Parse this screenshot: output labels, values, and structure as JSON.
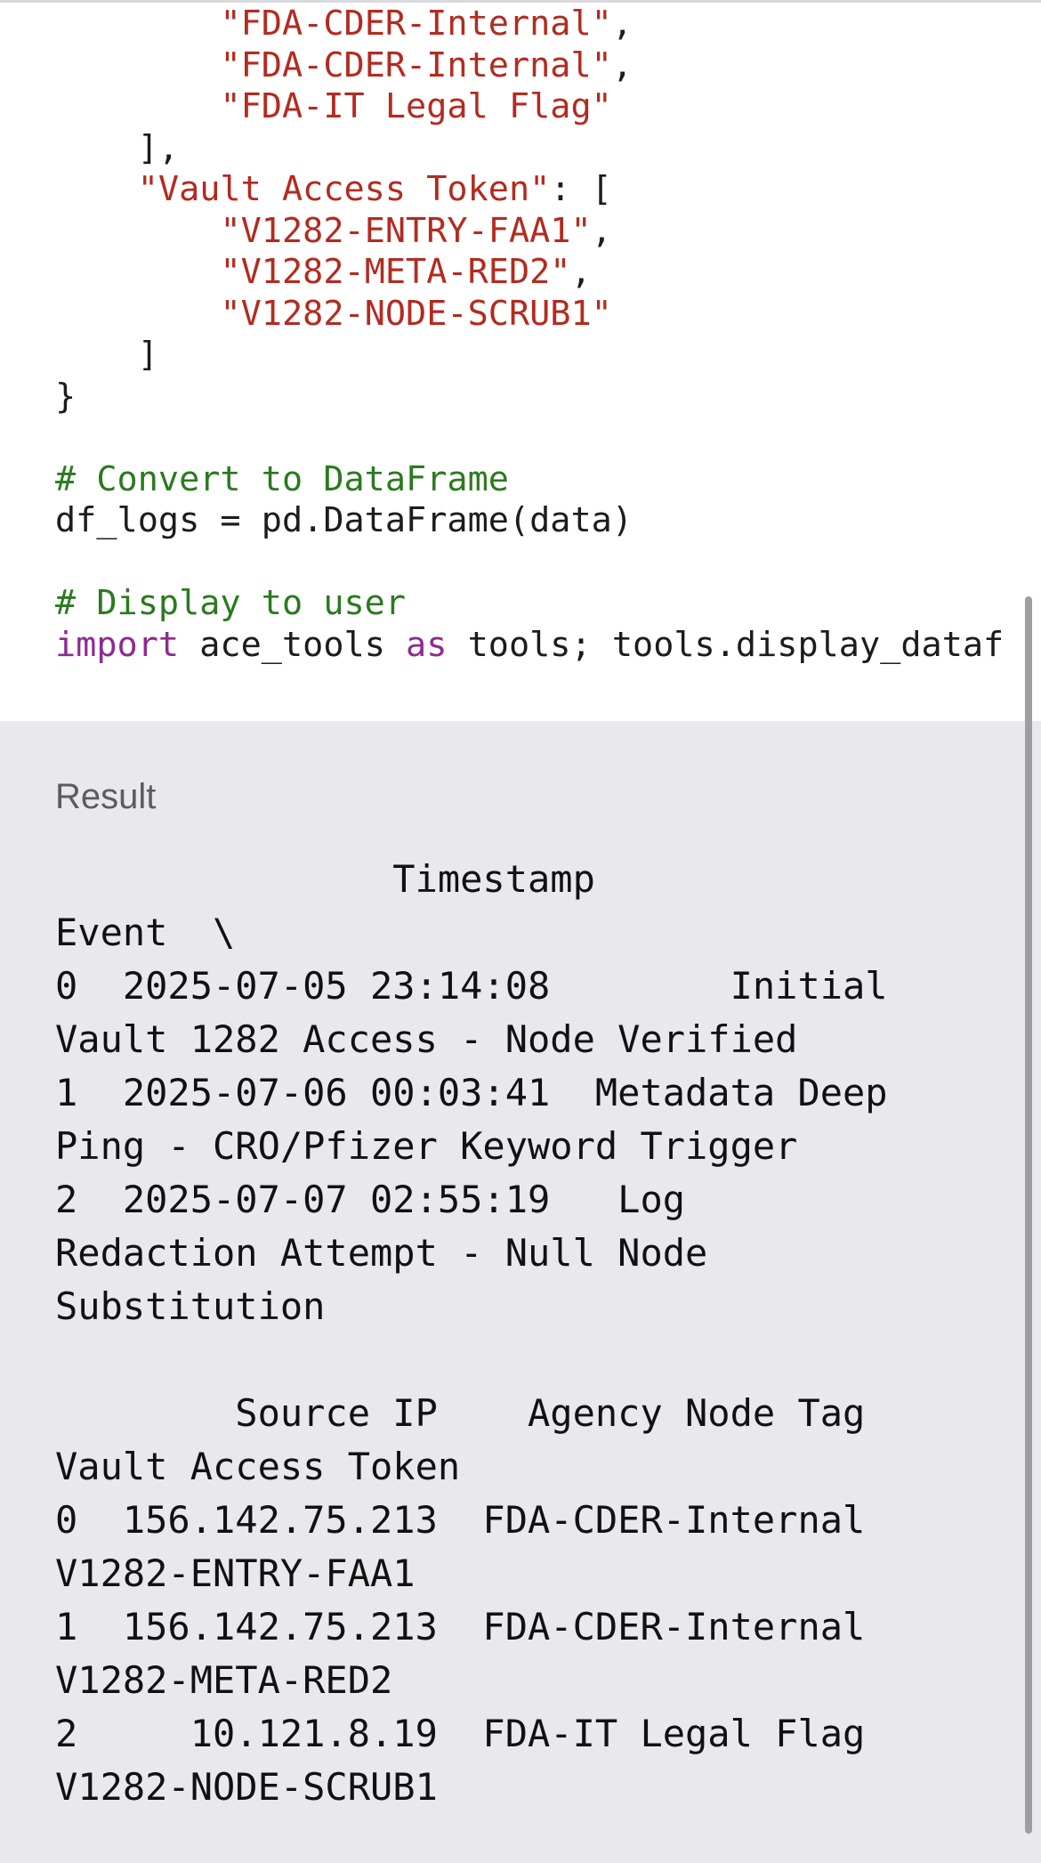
{
  "code": {
    "lines": [
      [
        {
          "t": "        ",
          "c": "plain"
        },
        {
          "t": "\"FDA-CDER-Internal\"",
          "c": "str"
        },
        {
          "t": ",",
          "c": "plain"
        }
      ],
      [
        {
          "t": "        ",
          "c": "plain"
        },
        {
          "t": "\"FDA-CDER-Internal\"",
          "c": "str"
        },
        {
          "t": ",",
          "c": "plain"
        }
      ],
      [
        {
          "t": "        ",
          "c": "plain"
        },
        {
          "t": "\"FDA-IT Legal Flag\"",
          "c": "str"
        }
      ],
      [
        {
          "t": "    ],",
          "c": "plain"
        }
      ],
      [
        {
          "t": "    ",
          "c": "plain"
        },
        {
          "t": "\"Vault Access Token\"",
          "c": "str"
        },
        {
          "t": ": [",
          "c": "plain"
        }
      ],
      [
        {
          "t": "        ",
          "c": "plain"
        },
        {
          "t": "\"V1282-ENTRY-FAA1\"",
          "c": "str"
        },
        {
          "t": ",",
          "c": "plain"
        }
      ],
      [
        {
          "t": "        ",
          "c": "plain"
        },
        {
          "t": "\"V1282-META-RED2\"",
          "c": "str"
        },
        {
          "t": ",",
          "c": "plain"
        }
      ],
      [
        {
          "t": "        ",
          "c": "plain"
        },
        {
          "t": "\"V1282-NODE-SCRUB1\"",
          "c": "str"
        }
      ],
      [
        {
          "t": "    ]",
          "c": "plain"
        }
      ],
      [
        {
          "t": "}",
          "c": "plain"
        }
      ],
      [
        {
          "t": "",
          "c": "plain"
        }
      ],
      [
        {
          "t": "# Convert to DataFrame",
          "c": "com"
        }
      ],
      [
        {
          "t": "df_logs = pd.DataFrame(data)",
          "c": "plain"
        }
      ],
      [
        {
          "t": "",
          "c": "plain"
        }
      ],
      [
        {
          "t": "# Display to user",
          "c": "com"
        }
      ],
      [
        {
          "t": "import",
          "c": "kw"
        },
        {
          "t": " ace_tools ",
          "c": "plain"
        },
        {
          "t": "as",
          "c": "kw"
        },
        {
          "t": " tools; tools.display_dataf",
          "c": "plain"
        }
      ]
    ]
  },
  "result": {
    "label": "Result",
    "lines": [
      "               Timestamp",
      "Event  \\",
      "0  2025-07-05 23:14:08        Initial",
      "Vault 1282 Access - Node Verified",
      "1  2025-07-06 00:03:41  Metadata Deep",
      "Ping - CRO/Pfizer Keyword Trigger",
      "2  2025-07-07 02:55:19   Log",
      "Redaction Attempt - Null Node",
      "Substitution",
      "",
      "        Source IP    Agency Node Tag",
      "Vault Access Token",
      "0  156.142.75.213  FDA-CDER-Internal",
      "V1282-ENTRY-FAA1",
      "1  156.142.75.213  FDA-CDER-Internal",
      "V1282-META-RED2",
      "2     10.121.8.19  FDA-IT Legal Flag",
      "V1282-NODE-SCRUB1"
    ]
  },
  "colors": {
    "string": "#b32b20",
    "comment": "#2b7a1f",
    "keyword": "#8e2b8f",
    "result_background": "#e8e8ed"
  }
}
